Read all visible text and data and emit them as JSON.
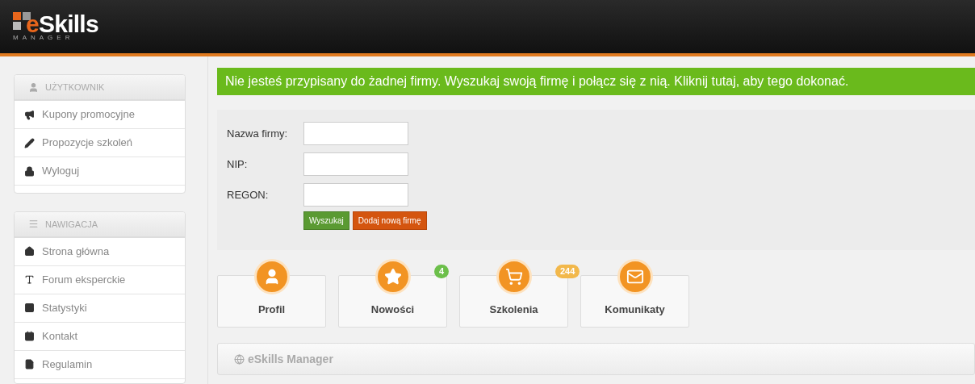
{
  "header": {
    "logo_word_accent": "e",
    "logo_word": "Skills",
    "logo_subtitle": "MANAGER"
  },
  "sidebar": {
    "panels": [
      {
        "title": "UŻYTKOWNIK",
        "items": [
          "Kupony promocyjne",
          "Propozycje szkoleń",
          "Wyloguj"
        ]
      },
      {
        "title": "NAWIGACJA",
        "items": [
          "Strona główna",
          "Forum eksperckie",
          "Statystyki",
          "Kontakt",
          "Regulamin"
        ]
      }
    ]
  },
  "alert": {
    "text": "Nie jesteś przypisany do żadnej firmy. Wyszukaj swoją firmę i połącz się z nią. Kliknij tutaj, aby tego dokonać."
  },
  "form": {
    "fields": [
      {
        "label": "Nazwa firmy:"
      },
      {
        "label": "NIP:"
      },
      {
        "label": "REGON:"
      }
    ],
    "buttons": [
      {
        "label": "Wyszukaj",
        "kind": "search"
      },
      {
        "label": "Dodaj nową firmę",
        "kind": "add"
      }
    ]
  },
  "tiles": [
    {
      "label": "Profil"
    },
    {
      "label": "Nowości",
      "badge": "4",
      "color": "#6cbf4a"
    },
    {
      "label": "Szkolenia",
      "badge": "244",
      "color": "#f2b84b"
    },
    {
      "label": "Komunikaty"
    }
  ],
  "bottom_panel": {
    "title": "eSkills Manager"
  }
}
